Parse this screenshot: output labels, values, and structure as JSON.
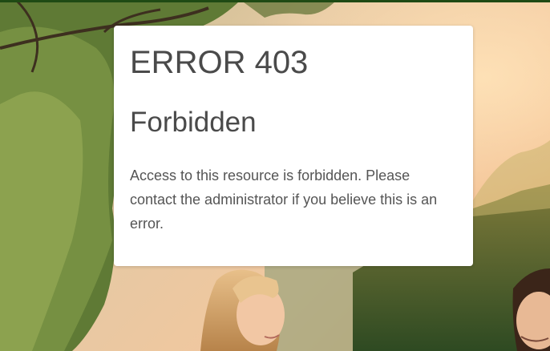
{
  "error": {
    "code": "ERROR 403",
    "title": "Forbidden",
    "message": "Access to this resource is forbidden. Please contact the administrator if you believe this is an error."
  },
  "colors": {
    "top_bar": "#1f4a14",
    "card_background": "#ffffff",
    "heading_text": "#4a4a4a",
    "body_text": "#555555"
  }
}
